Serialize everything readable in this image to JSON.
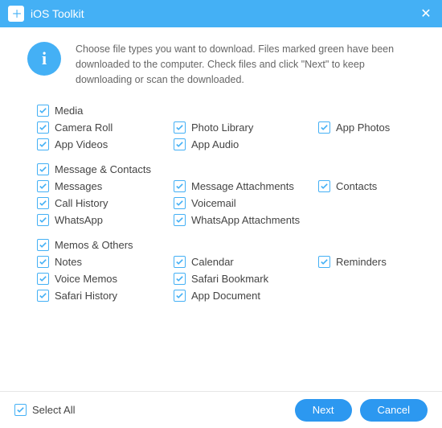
{
  "titlebar": {
    "app_name": "iOS Toolkit"
  },
  "info": {
    "text": "Choose file types you want to download. Files marked green have been downloaded to the computer. Check files and click \"Next\" to keep downloading or scan the downloaded."
  },
  "groups": [
    {
      "header": "Media",
      "items": [
        {
          "label": "Camera Roll",
          "checked": true
        },
        {
          "label": "Photo Library",
          "checked": true
        },
        {
          "label": "App Photos",
          "checked": true
        },
        {
          "label": "App Videos",
          "checked": true
        },
        {
          "label": "App Audio",
          "checked": true
        }
      ]
    },
    {
      "header": "Message & Contacts",
      "items": [
        {
          "label": "Messages",
          "checked": true
        },
        {
          "label": "Message Attachments",
          "checked": true
        },
        {
          "label": "Contacts",
          "checked": true
        },
        {
          "label": "Call History",
          "checked": true
        },
        {
          "label": "Voicemail",
          "checked": true
        },
        {
          "label": "",
          "checked": null
        },
        {
          "label": "WhatsApp",
          "checked": true
        },
        {
          "label": "WhatsApp Attachments",
          "checked": true
        }
      ]
    },
    {
      "header": "Memos & Others",
      "items": [
        {
          "label": "Notes",
          "checked": true
        },
        {
          "label": "Calendar",
          "checked": true
        },
        {
          "label": "Reminders",
          "checked": true
        },
        {
          "label": "Voice Memos",
          "checked": true
        },
        {
          "label": "Safari Bookmark",
          "checked": true
        },
        {
          "label": "",
          "checked": null
        },
        {
          "label": "Safari History",
          "checked": true
        },
        {
          "label": "App Document",
          "checked": true
        }
      ]
    }
  ],
  "footer": {
    "select_all": "Select All",
    "select_all_checked": true,
    "next": "Next",
    "cancel": "Cancel"
  },
  "colors": {
    "accent": "#44b0f5",
    "button": "#2c98f0"
  }
}
